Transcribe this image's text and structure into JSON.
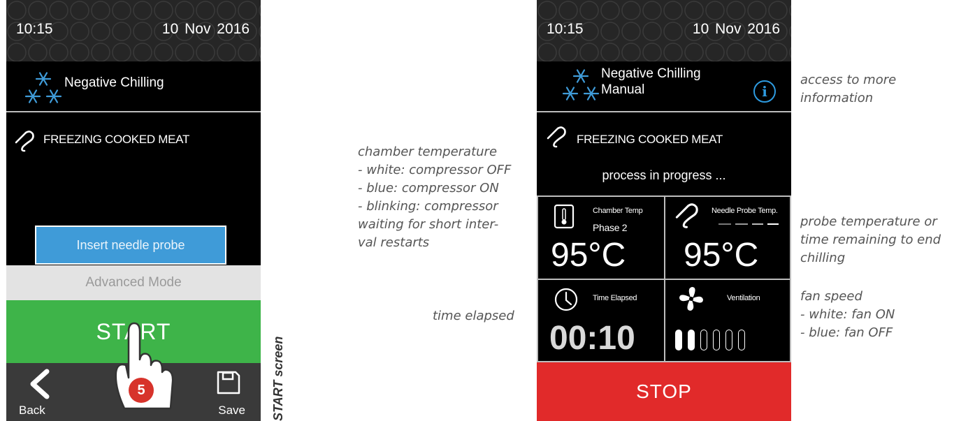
{
  "left_screen": {
    "status": {
      "time": "10:15",
      "date": "10 Nov 2016"
    },
    "mode_title": "Negative Chilling",
    "program_name": "FREEZING COOKED MEAT",
    "insert_probe_label": "Insert needle probe",
    "advanced_mode_label": "Advanced Mode",
    "start_label": "START",
    "back_label": "Back",
    "save_label": "Save",
    "step_number": "5"
  },
  "left_caption": "START screen",
  "right_screen": {
    "status": {
      "time": "10:15",
      "date": "10 Nov 2016"
    },
    "mode_title": "Negative Chilling",
    "mode_subtitle": "Manual",
    "program_name": "FREEZING COOKED MEAT",
    "progress_text": "process in progress ...",
    "chamber": {
      "label": "Chamber Temp",
      "phase": "Phase 2",
      "value": "95°C"
    },
    "probe": {
      "label": "Needle Probe Temp.",
      "value": "95°C"
    },
    "elapsed": {
      "label": "Time Elapsed",
      "value": "00:10"
    },
    "ventilation": {
      "label": "Ventilation",
      "levels_on": 2,
      "levels_total": 6
    },
    "stop_label": "STOP"
  },
  "annotations": {
    "chamber": [
      "chamber temperature",
      "- white: compressor OFF",
      "- blue: compressor ON",
      "- blinking: compressor",
      "waiting for short inter-",
      "val restarts"
    ],
    "time_elapsed": "time elapsed",
    "info": [
      "access to more",
      "information"
    ],
    "probe": [
      "probe temperature or",
      "time remaining to end",
      "chilling"
    ],
    "fan": [
      "fan speed",
      "- white: fan ON",
      "- blue: fan OFF"
    ]
  },
  "colors": {
    "start_green": "#3eb449",
    "stop_red": "#e12a2a",
    "insert_blue": "#3f9bd8",
    "accent_blue": "#2e9be0"
  }
}
